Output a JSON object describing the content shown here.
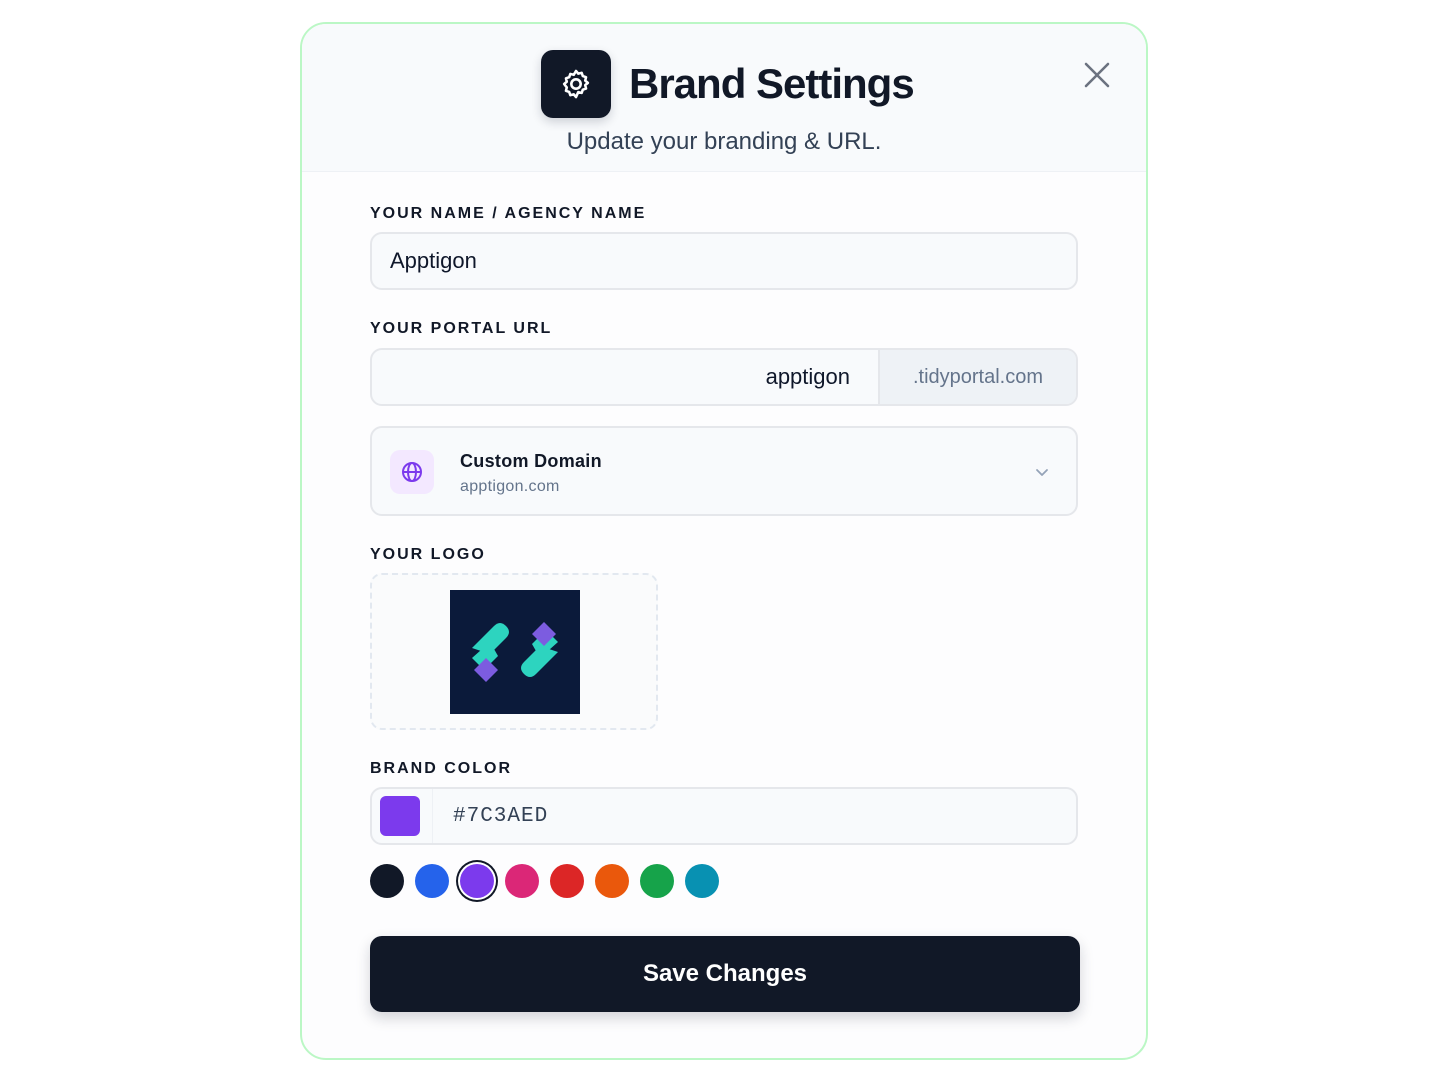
{
  "header": {
    "title": "Brand Settings",
    "subtitle": "Update your branding & URL.",
    "icon": "gear-icon",
    "close_icon": "close-icon"
  },
  "name_field": {
    "label": "YOUR NAME / AGENCY NAME",
    "value": "Apptigon"
  },
  "portal_url": {
    "label": "YOUR PORTAL URL",
    "value": "apptigon",
    "suffix": ".tidyportal.com"
  },
  "custom_domain": {
    "title": "Custom Domain",
    "value": "apptigon.com",
    "icon": "globe-icon",
    "expand_icon": "chevron-down-icon"
  },
  "logo": {
    "label": "YOUR LOGO"
  },
  "brand_color": {
    "label": "BRAND COLOR",
    "value": "#7C3AED",
    "swatches": [
      {
        "color": "#111827",
        "selected": false
      },
      {
        "color": "#2563EB",
        "selected": false
      },
      {
        "color": "#7C3AED",
        "selected": true
      },
      {
        "color": "#DB2777",
        "selected": false
      },
      {
        "color": "#DC2626",
        "selected": false
      },
      {
        "color": "#EA580C",
        "selected": false
      },
      {
        "color": "#16A34A",
        "selected": false
      },
      {
        "color": "#0891B2",
        "selected": false
      }
    ]
  },
  "actions": {
    "save_label": "Save Changes"
  }
}
